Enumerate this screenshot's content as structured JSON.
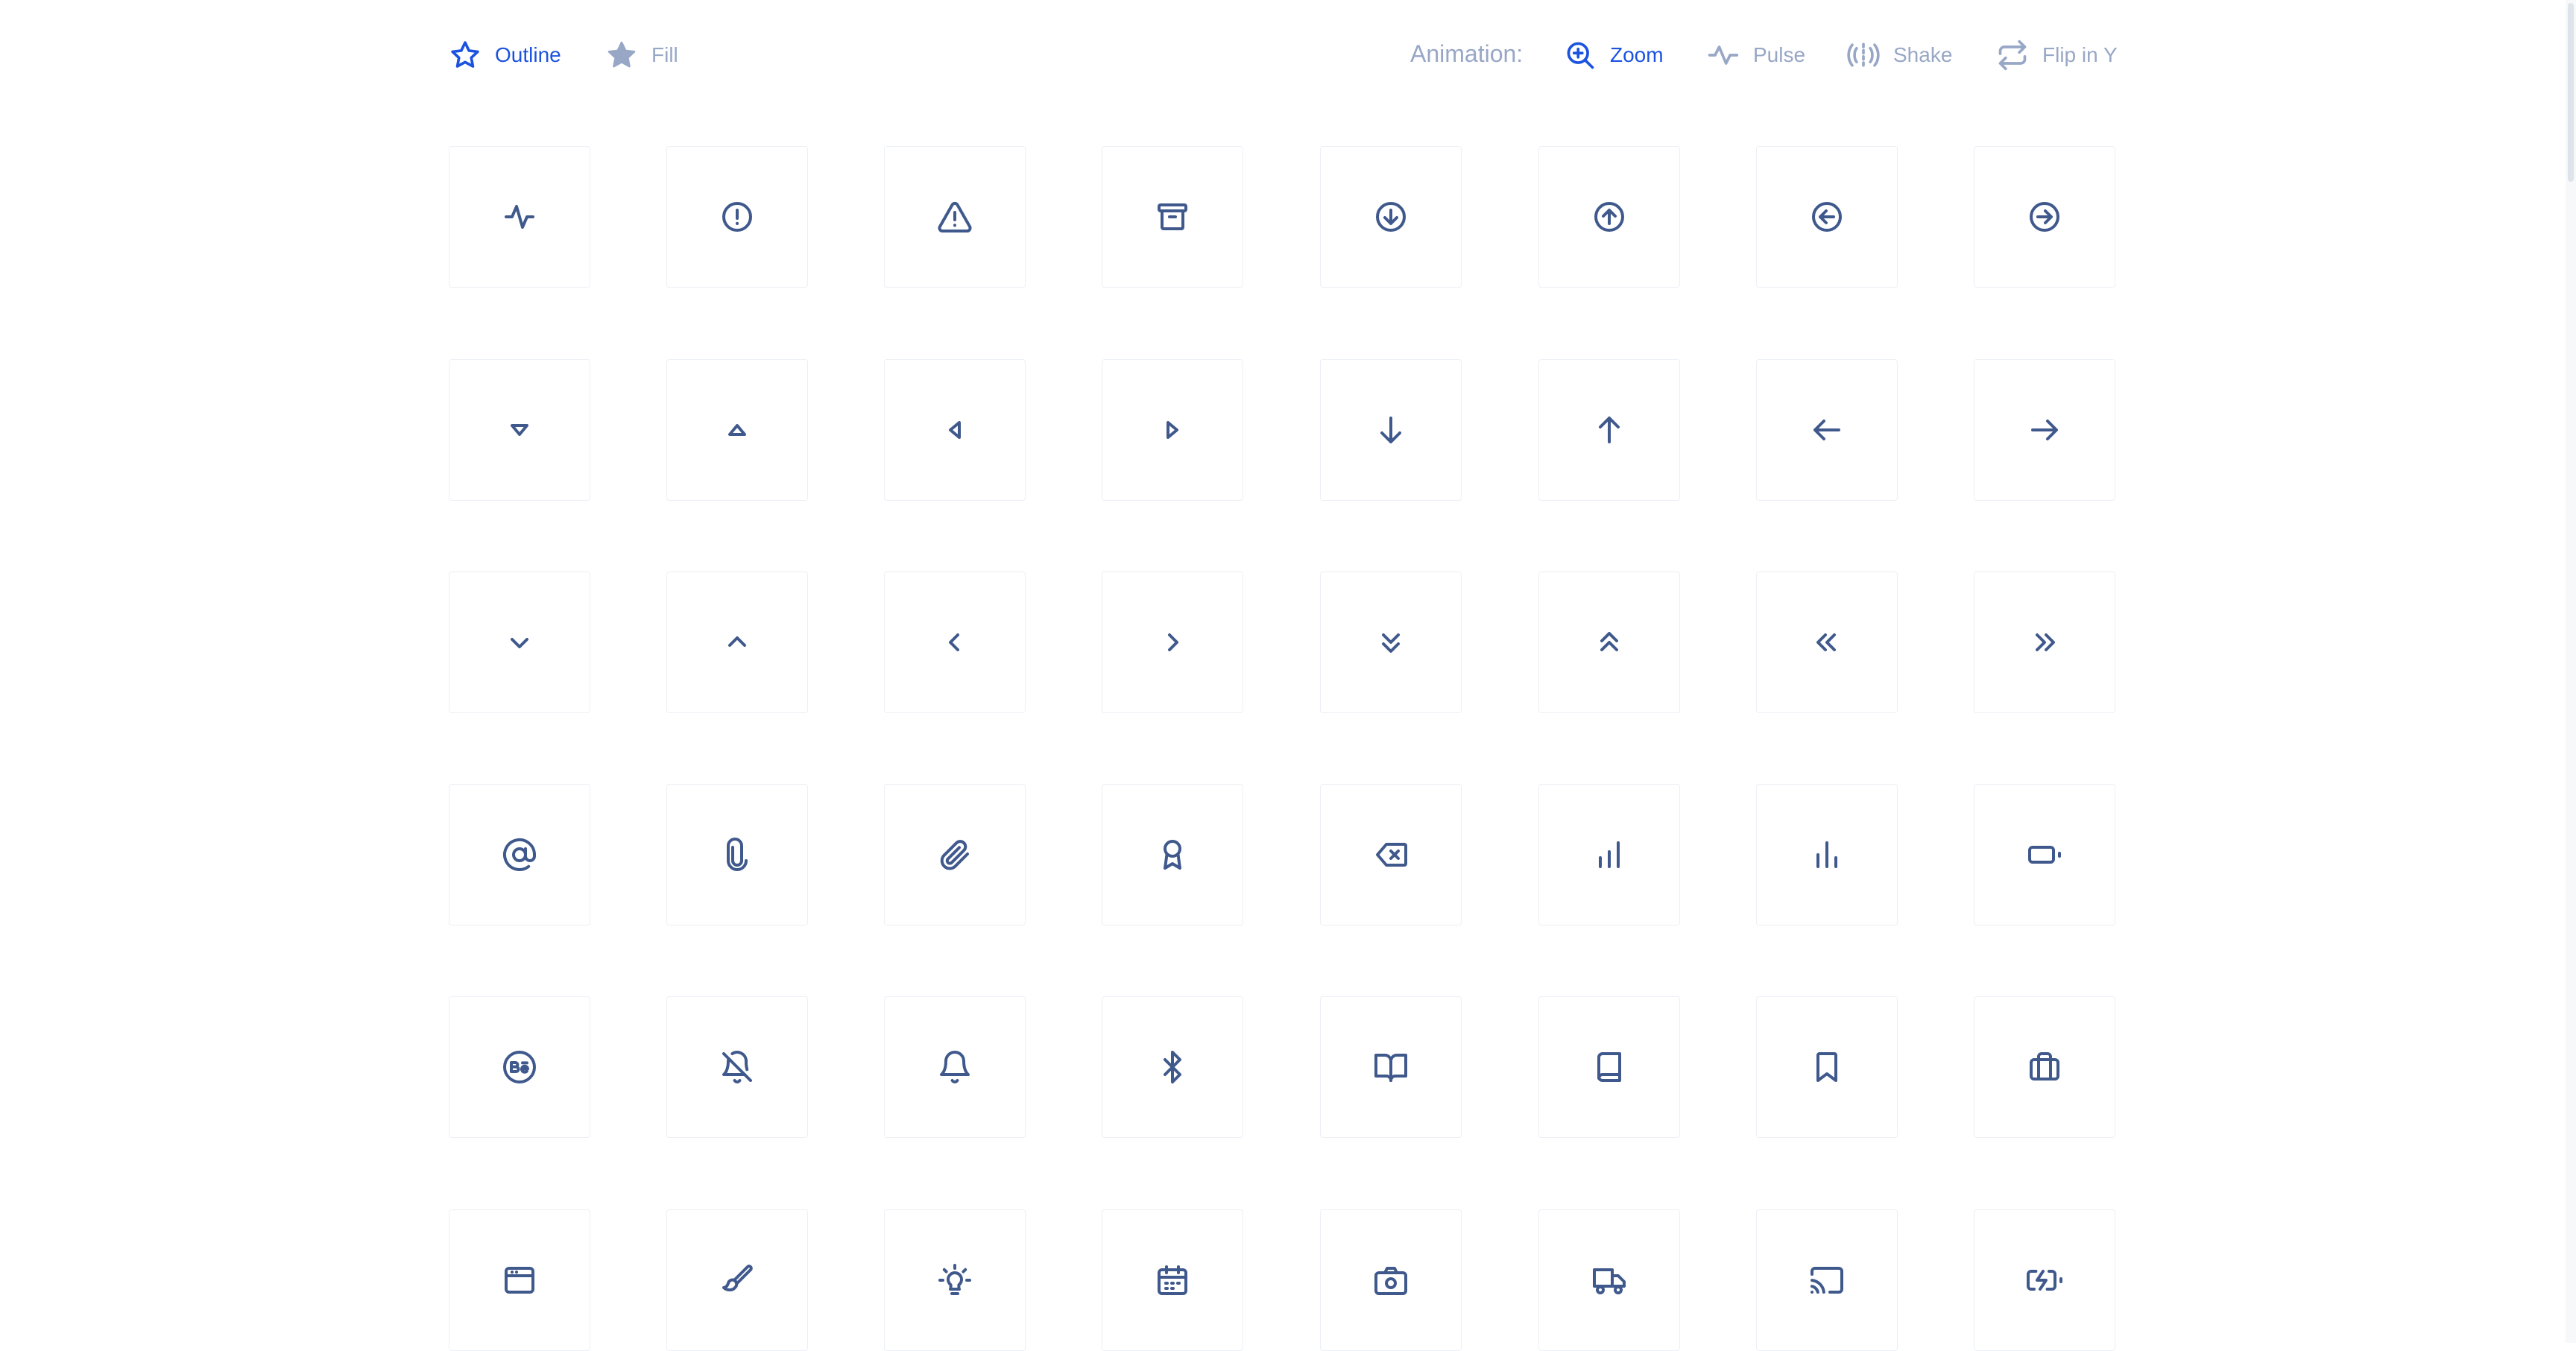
{
  "style_toggle": {
    "outline_label": "Outline",
    "fill_label": "Fill",
    "active": "outline"
  },
  "animation": {
    "label": "Animation:",
    "options": [
      {
        "label": "Zoom",
        "icon": "zoom-in-icon"
      },
      {
        "label": "Pulse",
        "icon": "pulse-icon"
      },
      {
        "label": "Shake",
        "icon": "shake-icon"
      },
      {
        "label": "Flip in Y",
        "icon": "repeat-icon"
      }
    ],
    "active": "Zoom"
  },
  "colors": {
    "accent": "#1b53e0",
    "muted": "#98a7c6",
    "icon": "#40598c",
    "cell_border": "#eceff4"
  },
  "icons": [
    [
      "activity-icon",
      "alert-circle-icon",
      "alert-triangle-icon",
      "archive-icon",
      "arrow-down-circle-icon",
      "arrow-up-circle-icon",
      "arrow-left-circle-icon",
      "arrow-right-circle-icon"
    ],
    [
      "caret-down-icon",
      "caret-up-icon",
      "caret-left-icon",
      "caret-right-icon",
      "arrow-down-icon",
      "arrow-up-icon",
      "arrow-left-icon",
      "arrow-right-icon"
    ],
    [
      "chevron-down-icon",
      "chevron-up-icon",
      "chevron-left-icon",
      "chevron-right-icon",
      "chevrons-down-icon",
      "chevrons-up-icon",
      "chevrons-left-icon",
      "chevrons-right-icon"
    ],
    [
      "at-sign-icon",
      "paperclip-icon",
      "attachment-icon",
      "award-icon",
      "backspace-icon",
      "bar-chart-icon",
      "bar-chart-alt-icon",
      "battery-icon"
    ],
    [
      "behance-icon",
      "bell-off-icon",
      "bell-icon",
      "bluetooth-icon",
      "book-open-icon",
      "book-icon",
      "bookmark-icon",
      "briefcase-icon"
    ],
    [
      "browser-icon",
      "brush-icon",
      "bulb-icon",
      "calendar-icon",
      "camera-icon",
      "truck-icon",
      "cast-icon",
      "battery-charging-icon"
    ]
  ]
}
